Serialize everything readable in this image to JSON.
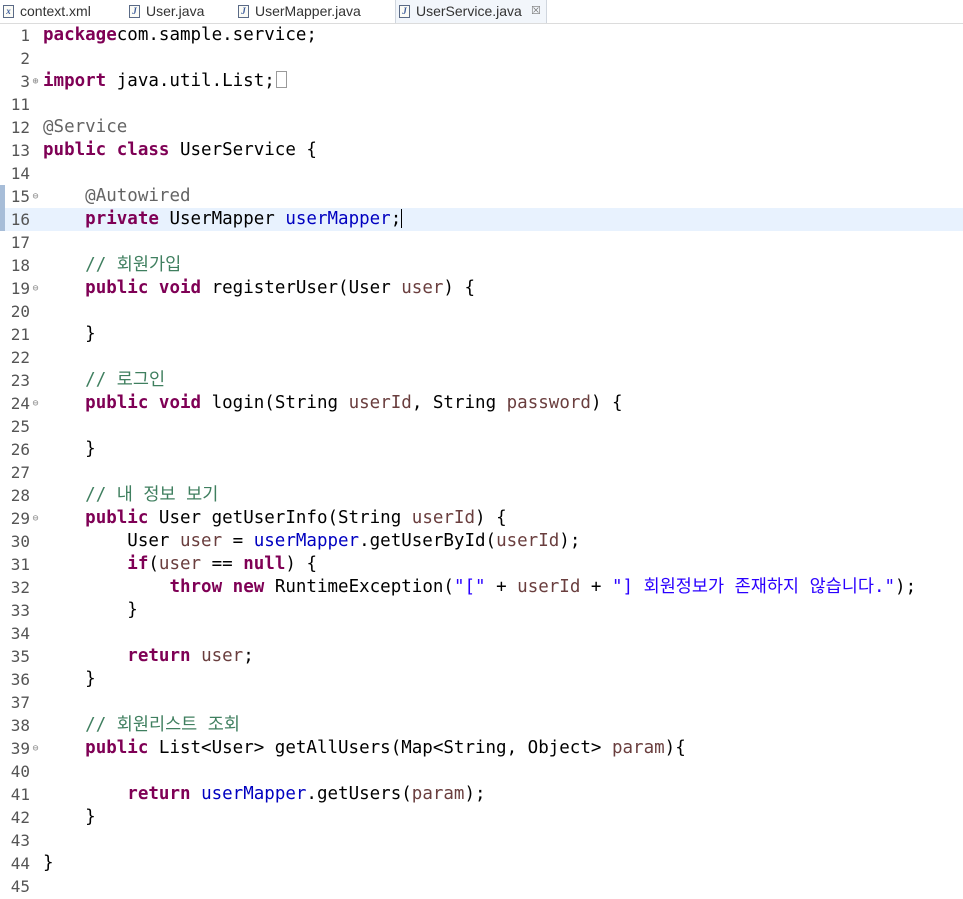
{
  "tabs": [
    {
      "label": "context.xml",
      "icon": "xml-file-icon"
    },
    {
      "label": "User.java",
      "icon": "java-file-icon"
    },
    {
      "label": "UserMapper.java",
      "icon": "java-file-icon"
    },
    {
      "label": "UserService.java",
      "icon": "java-file-icon",
      "active": true,
      "close": "☒"
    }
  ],
  "editor": {
    "current_line": "16",
    "lines": [
      {
        "n": "1",
        "t": [
          [
            "kw",
            "package"
          ],
          [
            "",
            "com.sample.service;"
          ]
        ]
      },
      {
        "n": "2",
        "t": []
      },
      {
        "n": "3",
        "fold": "⊕",
        "t": [
          [
            "kw",
            "import"
          ],
          [
            "",
            " java.util.List;"
          ]
        ],
        "collapsed": true
      },
      {
        "n": "11",
        "t": []
      },
      {
        "n": "12",
        "t": [
          [
            "ann",
            "@Service"
          ]
        ]
      },
      {
        "n": "13",
        "t": [
          [
            "kw",
            "public"
          ],
          [
            "",
            " "
          ],
          [
            "kw",
            "class"
          ],
          [
            "",
            " UserService {"
          ]
        ]
      },
      {
        "n": "14",
        "t": []
      },
      {
        "n": "15",
        "fold": "⊖",
        "marker": true,
        "t": [
          [
            "",
            " "
          ],
          [
            "ann",
            "@Autowired"
          ]
        ]
      },
      {
        "n": "16",
        "marker": true,
        "caret": true,
        "t": [
          [
            "",
            " "
          ],
          [
            "kw",
            "private"
          ],
          [
            "",
            " UserMapper "
          ],
          [
            "fld",
            "userMapper"
          ],
          [
            "",
            ";"
          ]
        ]
      },
      {
        "n": "17",
        "t": []
      },
      {
        "n": "18",
        "t": [
          [
            "",
            " "
          ],
          [
            "cmt",
            "// 회원가입"
          ]
        ]
      },
      {
        "n": "19",
        "fold": "⊖",
        "t": [
          [
            "",
            " "
          ],
          [
            "kw",
            "public"
          ],
          [
            "",
            " "
          ],
          [
            "kw",
            "void"
          ],
          [
            "",
            " registerUser(User "
          ],
          [
            "var",
            "user"
          ],
          [
            "",
            ") {"
          ]
        ]
      },
      {
        "n": "20",
        "t": []
      },
      {
        "n": "21",
        "t": [
          [
            "",
            " }"
          ]
        ]
      },
      {
        "n": "22",
        "t": []
      },
      {
        "n": "23",
        "t": [
          [
            "",
            " "
          ],
          [
            "cmt",
            "// 로그인"
          ]
        ]
      },
      {
        "n": "24",
        "fold": "⊖",
        "t": [
          [
            "",
            " "
          ],
          [
            "kw",
            "public"
          ],
          [
            "",
            " "
          ],
          [
            "kw",
            "void"
          ],
          [
            "",
            " login(String "
          ],
          [
            "var",
            "userId"
          ],
          [
            "",
            ", String "
          ],
          [
            "var",
            "password"
          ],
          [
            "",
            ") {"
          ]
        ]
      },
      {
        "n": "25",
        "t": []
      },
      {
        "n": "26",
        "t": [
          [
            "",
            " }"
          ]
        ]
      },
      {
        "n": "27",
        "t": []
      },
      {
        "n": "28",
        "t": [
          [
            "",
            " "
          ],
          [
            "cmt",
            "// 내 정보 보기"
          ]
        ]
      },
      {
        "n": "29",
        "fold": "⊖",
        "t": [
          [
            "",
            " "
          ],
          [
            "kw",
            "public"
          ],
          [
            "",
            " User getUserInfo(String "
          ],
          [
            "var",
            "userId"
          ],
          [
            "",
            ") {"
          ]
        ]
      },
      {
        "n": "30",
        "t": [
          [
            "",
            " User "
          ],
          [
            "var",
            "user"
          ],
          [
            "",
            " = "
          ],
          [
            "fld",
            "userMapper"
          ],
          [
            "",
            ".getUserById("
          ],
          [
            "var",
            "userId"
          ],
          [
            "",
            ");"
          ]
        ]
      },
      {
        "n": "31",
        "t": [
          [
            "",
            " "
          ],
          [
            "kw",
            "if"
          ],
          [
            "",
            "("
          ],
          [
            "var",
            "user"
          ],
          [
            "",
            " == "
          ],
          [
            "kw",
            "null"
          ],
          [
            "",
            ") {"
          ]
        ]
      },
      {
        "n": "32",
        "t": [
          [
            "",
            " "
          ],
          [
            "kw",
            "throw"
          ],
          [
            "",
            " "
          ],
          [
            "kw",
            "new"
          ],
          [
            "",
            " RuntimeException("
          ],
          [
            "str",
            "\"[\""
          ],
          [
            "",
            " + "
          ],
          [
            "var",
            "userId"
          ],
          [
            "",
            " + "
          ],
          [
            "str",
            "\"] 회원정보가 존재하지 않습니다.\""
          ],
          [
            "",
            ");"
          ]
        ]
      },
      {
        "n": "33",
        "t": [
          [
            "",
            " }"
          ]
        ]
      },
      {
        "n": "34",
        "t": []
      },
      {
        "n": "35",
        "t": [
          [
            "",
            " "
          ],
          [
            "kw",
            "return"
          ],
          [
            "",
            " "
          ],
          [
            "var",
            "user"
          ],
          [
            "",
            ";"
          ]
        ]
      },
      {
        "n": "36",
        "t": [
          [
            "",
            " }"
          ]
        ]
      },
      {
        "n": "37",
        "t": []
      },
      {
        "n": "38",
        "t": [
          [
            "",
            " "
          ],
          [
            "cmt",
            "// 회원리스트 조회"
          ]
        ]
      },
      {
        "n": "39",
        "fold": "⊖",
        "t": [
          [
            "",
            " "
          ],
          [
            "kw",
            "public"
          ],
          [
            "",
            " List<User> getAllUsers(Map<String, Object> "
          ],
          [
            "var",
            "param"
          ],
          [
            "",
            "){"
          ]
        ]
      },
      {
        "n": "40",
        "t": []
      },
      {
        "n": "41",
        "t": [
          [
            "",
            " "
          ],
          [
            "kw",
            "return"
          ],
          [
            "",
            " "
          ],
          [
            "fld",
            "userMapper"
          ],
          [
            "",
            ".getUsers("
          ],
          [
            "var",
            "param"
          ],
          [
            "",
            ");"
          ]
        ]
      },
      {
        "n": "42",
        "t": [
          [
            "",
            " }"
          ]
        ]
      },
      {
        "n": "43",
        "t": []
      },
      {
        "n": "44",
        "t": [
          [
            "",
            "}"
          ]
        ]
      },
      {
        "n": "45",
        "t": []
      }
    ]
  }
}
